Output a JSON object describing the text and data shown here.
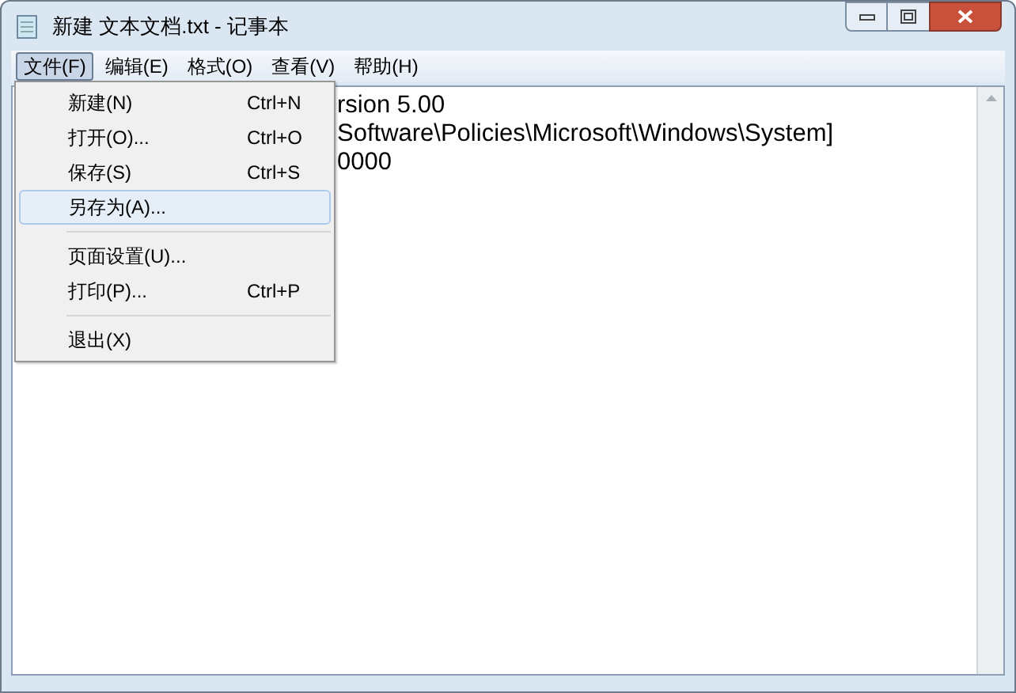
{
  "window": {
    "title": "新建 文本文档.txt - 记事本"
  },
  "menu_bar": [
    {
      "label": "文件(F)",
      "selected": true
    },
    {
      "label": "编辑(E)",
      "selected": false
    },
    {
      "label": "格式(O)",
      "selected": false
    },
    {
      "label": "查看(V)",
      "selected": false
    },
    {
      "label": "帮助(H)",
      "selected": false
    }
  ],
  "document_lines": [
    "rsion 5.00",
    "Software\\Policies\\Microsoft\\Windows\\System]",
    "0000"
  ],
  "file_menu": [
    {
      "kind": "item",
      "label": "新建(N)",
      "shortcut": "Ctrl+N",
      "selected": false
    },
    {
      "kind": "item",
      "label": "打开(O)...",
      "shortcut": "Ctrl+O",
      "selected": false
    },
    {
      "kind": "item",
      "label": "保存(S)",
      "shortcut": "Ctrl+S",
      "selected": false
    },
    {
      "kind": "item",
      "label": "另存为(A)...",
      "selected": true
    },
    {
      "kind": "separator"
    },
    {
      "kind": "item",
      "label": "页面设置(U)...",
      "selected": false
    },
    {
      "kind": "item",
      "label": "打印(P)...",
      "shortcut": "Ctrl+P",
      "selected": false
    },
    {
      "kind": "separator"
    },
    {
      "kind": "item",
      "label": "退出(X)",
      "selected": false
    }
  ]
}
